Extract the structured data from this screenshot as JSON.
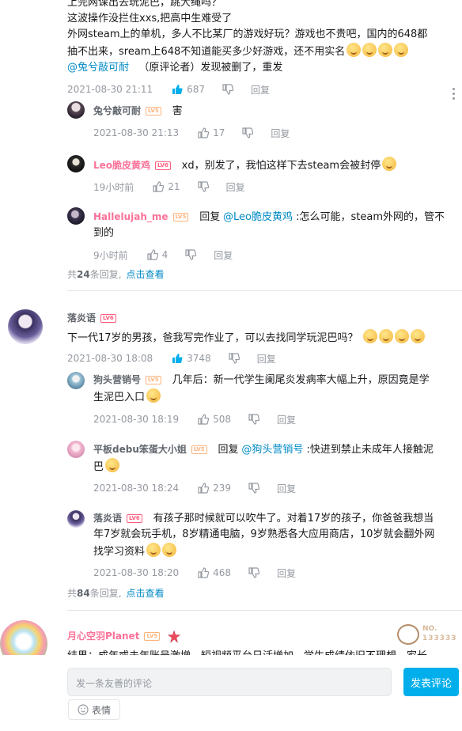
{
  "thread1": {
    "lines": [
      "上完网课出去玩泥巴，跳大绳吗？",
      "这波操作没拦住xxs,把高中生难受了",
      "外网steam上的单机，多人不比某厂的游戏好玩？游戏也不贵吧，国内的648都",
      "抽不出来，sream上648不知道能买多少好游戏，还不用实名"
    ],
    "mention": "@兔兮敲可耐",
    "after_mention": "（原评论者）发现被删了，重发",
    "time": "2021-08-30 21:11",
    "likes": "687",
    "reply_label": "回复",
    "replies": [
      {
        "name": "兔兮敲可耐",
        "level": "LV5",
        "text": "害",
        "time": "2021-08-30 21:13",
        "likes": "17",
        "reply_label": "回复"
      },
      {
        "name": "Leo脆皮黄鸡",
        "level": "LV6",
        "text": "xd，别发了，我怕这样下去steam会被封停",
        "time": "19小时前",
        "likes": "21",
        "reply_label": "回复"
      },
      {
        "name": "Hallelujah_me",
        "level": "LV5",
        "prefix": "回复",
        "mention": "@Leo脆皮黄鸡",
        "text_line1": " :怎么可能，steam外网的，管不",
        "text_line2": "到的",
        "time": "9小时前",
        "likes": "4",
        "reply_label": "回复"
      }
    ],
    "summary_prefix": "共",
    "summary_count": "24",
    "summary_suffix": "条回复,",
    "summary_link": "点击查看"
  },
  "thread2": {
    "name": "落炎语",
    "level": "LV6",
    "text": "下一代17岁的男孩，爸我写完作业了，可以去找同学玩泥巴吗？",
    "time": "2021-08-30 18:08",
    "likes": "3748",
    "reply_label": "回复",
    "replies": [
      {
        "name": "狗头营销号",
        "level": "LV5",
        "text_line1": "几年后：新一代学生阑尾炎发病率大幅上升，原因竟是学",
        "text_line2": "生泥巴入口",
        "time": "2021-08-30 18:19",
        "likes": "508",
        "reply_label": "回复"
      },
      {
        "name": "平板debu笨蛋大小姐",
        "level": "LV5",
        "prefix": "回复",
        "mention": "@狗头营销号",
        "text_line1": " :快进到禁止未成年人接触泥",
        "text_line2": "巴",
        "time": "2021-08-30 18:24",
        "likes": "239",
        "reply_label": "回复"
      },
      {
        "name": "落炎语",
        "level": "LV6",
        "text_line1": "有孩子那时候就可以吹牛了。对着17岁的孩子，你爸爸我想当",
        "text_line2": "年7岁就会玩手机，8岁精通电脑，9岁熟悉各大应用商店，10岁就会翻外网",
        "text_line3": "找学习资料",
        "time": "2021-08-30 18:20",
        "likes": "468",
        "reply_label": "回复"
      }
    ],
    "summary_prefix": "共",
    "summary_count": "84",
    "summary_suffix": "条回复,",
    "summary_link": "点击查看"
  },
  "thread3": {
    "name": "月心空羽Planet",
    "level": "LV5",
    "badge_text": "NO.",
    "badge_number": "133333",
    "partial_text": "结果：成年或未年账号激增，短视频平台日活增加，学生成绩依旧不理想，家长"
  },
  "bottom": {
    "placeholder": "发一条友善的评论",
    "submit": "发表评论",
    "emoji_label": "表情"
  },
  "colors": {
    "accent": "#00aeec",
    "link": "#008ac5",
    "pink_name": "#fb7299",
    "meta": "#9499a0"
  }
}
